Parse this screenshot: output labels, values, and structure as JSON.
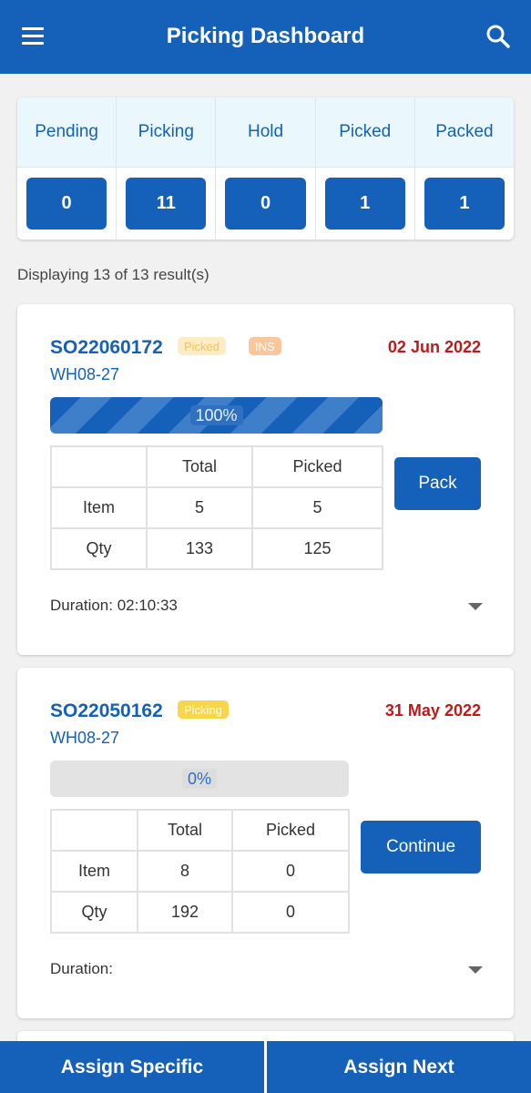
{
  "header": {
    "title": "Picking Dashboard",
    "menu_icon": "menu-icon",
    "search_icon": "search-icon"
  },
  "summary": [
    {
      "label": "Pending",
      "count": "0"
    },
    {
      "label": "Picking",
      "count": "11"
    },
    {
      "label": "Hold",
      "count": "0"
    },
    {
      "label": "Picked",
      "count": "1"
    },
    {
      "label": "Packed",
      "count": "1"
    }
  ],
  "results_text": "Displaying 13 of 13 result(s)",
  "orders": [
    {
      "order_no": "SO22060172",
      "badges": [
        {
          "text": "Picked",
          "color": "#fbe6b0",
          "text_color": "#f3c86a"
        },
        {
          "text": "INS",
          "color": "#f9c79b",
          "text_color": "#ffffff"
        }
      ],
      "date": "02 Jun 2022",
      "warehouse": "WH08-27",
      "progress_label": "100%",
      "progress_value": 1.0,
      "table": {
        "headers": [
          "",
          "Total",
          "Picked"
        ],
        "rows": [
          [
            "Item",
            "5",
            "5"
          ],
          [
            "Qty",
            "133",
            "125"
          ]
        ]
      },
      "action": "Pack",
      "duration": "Duration: 02:10:33"
    },
    {
      "order_no": "SO22050162",
      "badges": [
        {
          "text": "Picking",
          "color": "#f9d54a",
          "text_color": "#ffffff"
        }
      ],
      "date": "31 May 2022",
      "warehouse": "WH08-27",
      "progress_label": "0%",
      "progress_value": 0.0,
      "table": {
        "headers": [
          "",
          "Total",
          "Picked"
        ],
        "rows": [
          [
            "Item",
            "8",
            "0"
          ],
          [
            "Qty",
            "192",
            "0"
          ]
        ]
      },
      "action": "Continue",
      "duration": "Duration:"
    }
  ],
  "footer": {
    "assign_specific": "Assign Specific",
    "assign_next": "Assign Next"
  },
  "colors": {
    "primary": "#1560b8",
    "date_red": "#c41818",
    "header_bg": "#eaf7fc"
  }
}
